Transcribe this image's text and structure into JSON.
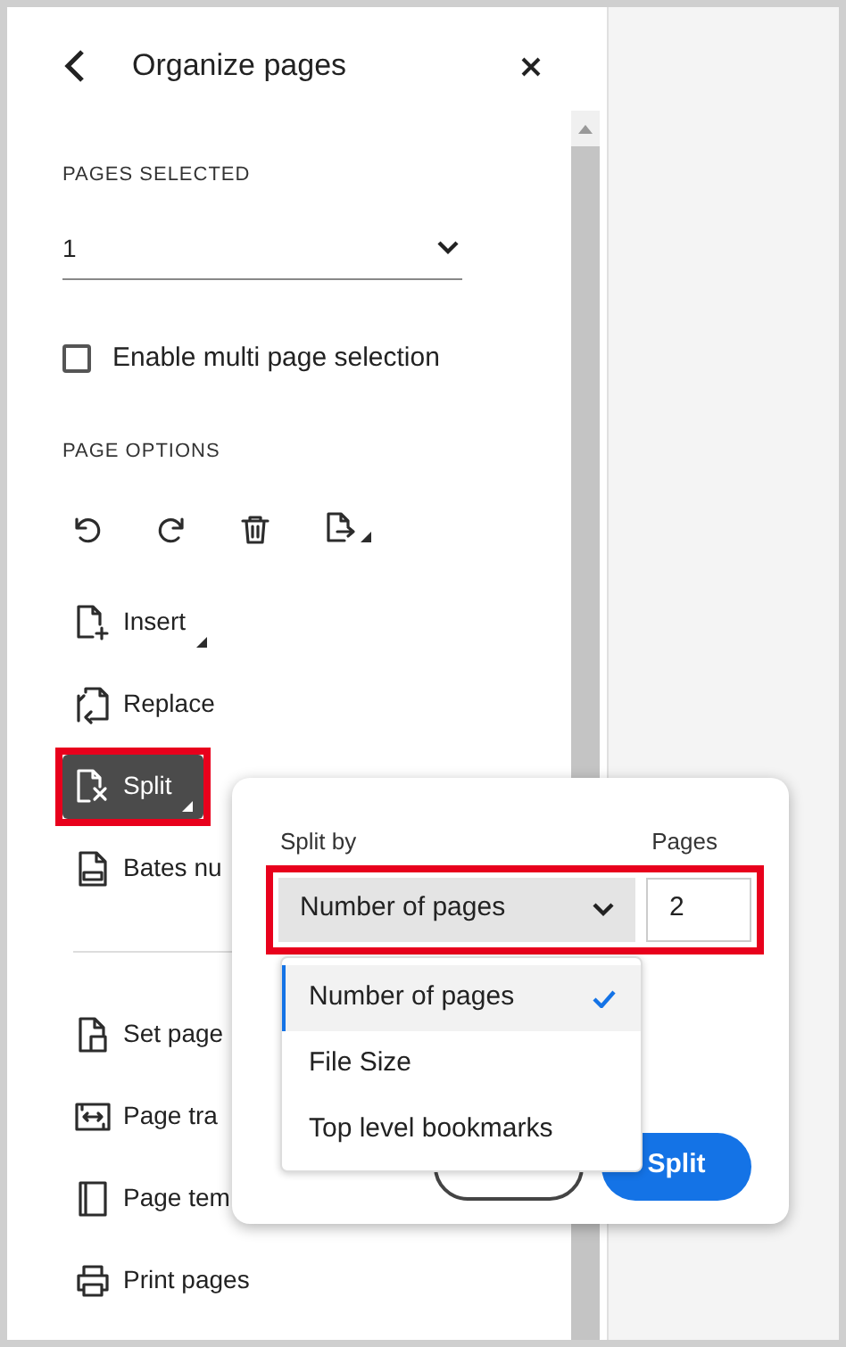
{
  "panel": {
    "title": "Organize pages"
  },
  "pages_selected": {
    "label": "PAGES SELECTED",
    "value": "1"
  },
  "multi_page": {
    "label": "Enable multi page selection",
    "checked": false
  },
  "page_options": {
    "label": "PAGE OPTIONS"
  },
  "tools": [
    {
      "kind": "rotate-left",
      "submenu": false
    },
    {
      "kind": "rotate-right",
      "submenu": false
    },
    {
      "kind": "delete",
      "submenu": false
    },
    {
      "kind": "extract",
      "submenu": true
    }
  ],
  "items": [
    {
      "kind": "insert",
      "label": "Insert",
      "submenu": true,
      "selected": false,
      "highlighted": false
    },
    {
      "kind": "replace",
      "label": "Replace",
      "submenu": false,
      "selected": false,
      "highlighted": false
    },
    {
      "kind": "split",
      "label": "Split",
      "submenu": true,
      "selected": true,
      "highlighted": true
    },
    {
      "kind": "bates",
      "label": "Bates nu",
      "submenu": false,
      "selected": false,
      "highlighted": false
    },
    {
      "kind": "divider"
    },
    {
      "kind": "set-page",
      "label": "Set page",
      "submenu": false,
      "selected": false,
      "highlighted": false
    },
    {
      "kind": "transitions",
      "label": "Page tra",
      "submenu": false,
      "selected": false,
      "highlighted": false
    },
    {
      "kind": "templates",
      "label": "Page tem",
      "submenu": false,
      "selected": false,
      "highlighted": false
    },
    {
      "kind": "print",
      "label": "Print pages",
      "submenu": false,
      "selected": false,
      "highlighted": false
    }
  ],
  "split_popover": {
    "split_by_label": "Split by",
    "pages_label": "Pages",
    "split_by_value": "Number of pages",
    "pages_value": "2",
    "highlighted": true,
    "options": [
      {
        "label": "Number of pages",
        "selected": true
      },
      {
        "label": "File Size",
        "selected": false
      },
      {
        "label": "Top level bookmarks",
        "selected": false
      }
    ],
    "submit": "Split"
  }
}
